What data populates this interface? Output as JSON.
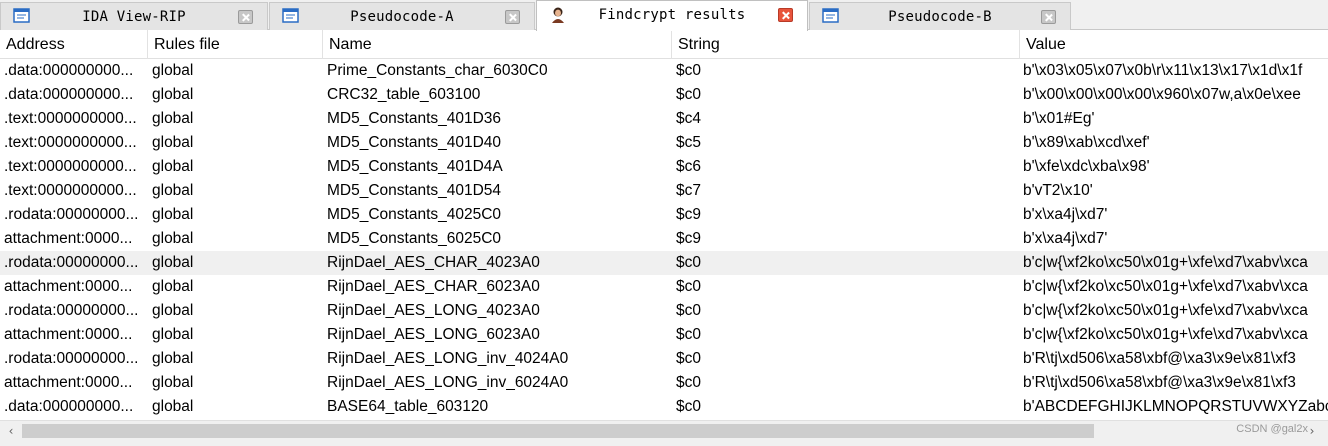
{
  "tabs": [
    {
      "label": "IDA View-RIP",
      "icon": "ida-view-icon",
      "active": false
    },
    {
      "label": "Pseudocode-A",
      "icon": "pseudocode-icon",
      "active": false
    },
    {
      "label": "Findcrypt results",
      "icon": "findcrypt-icon",
      "active": true
    },
    {
      "label": "Pseudocode-B",
      "icon": "pseudocode-icon",
      "active": false
    }
  ],
  "columns": {
    "address": "Address",
    "rules_file": "Rules file",
    "name": "Name",
    "string": "String",
    "value": "Value"
  },
  "rows": [
    {
      "address": ".data:000000000...",
      "rules_file": "global",
      "name": "Prime_Constants_char_6030C0",
      "string": "$c0",
      "value": "b'\\x03\\x05\\x07\\x0b\\r\\x11\\x13\\x17\\x1d\\x1f"
    },
    {
      "address": ".data:000000000...",
      "rules_file": "global",
      "name": "CRC32_table_603100",
      "string": "$c0",
      "value": "b'\\x00\\x00\\x00\\x00\\x960\\x07w,a\\x0e\\xee"
    },
    {
      "address": ".text:0000000000...",
      "rules_file": "global",
      "name": "MD5_Constants_401D36",
      "string": "$c4",
      "value": "b'\\x01#Eg'"
    },
    {
      "address": ".text:0000000000...",
      "rules_file": "global",
      "name": "MD5_Constants_401D40",
      "string": "$c5",
      "value": "b'\\x89\\xab\\xcd\\xef'"
    },
    {
      "address": ".text:0000000000...",
      "rules_file": "global",
      "name": "MD5_Constants_401D4A",
      "string": "$c6",
      "value": "b'\\xfe\\xdc\\xba\\x98'"
    },
    {
      "address": ".text:0000000000...",
      "rules_file": "global",
      "name": "MD5_Constants_401D54",
      "string": "$c7",
      "value": "b'vT2\\x10'"
    },
    {
      "address": ".rodata:00000000...",
      "rules_file": "global",
      "name": "MD5_Constants_4025C0",
      "string": "$c9",
      "value": "b'x\\xa4j\\xd7'"
    },
    {
      "address": "attachment:0000...",
      "rules_file": "global",
      "name": "MD5_Constants_6025C0",
      "string": "$c9",
      "value": "b'x\\xa4j\\xd7'"
    },
    {
      "address": ".rodata:00000000...",
      "rules_file": "global",
      "name": "RijnDael_AES_CHAR_4023A0",
      "string": "$c0",
      "value": "b'c|w{\\xf2ko\\xc50\\x01g+\\xfe\\xd7\\xabv\\xca"
    },
    {
      "address": "attachment:0000...",
      "rules_file": "global",
      "name": "RijnDael_AES_CHAR_6023A0",
      "string": "$c0",
      "value": "b'c|w{\\xf2ko\\xc50\\x01g+\\xfe\\xd7\\xabv\\xca"
    },
    {
      "address": ".rodata:00000000...",
      "rules_file": "global",
      "name": "RijnDael_AES_LONG_4023A0",
      "string": "$c0",
      "value": "b'c|w{\\xf2ko\\xc50\\x01g+\\xfe\\xd7\\xabv\\xca"
    },
    {
      "address": "attachment:0000...",
      "rules_file": "global",
      "name": "RijnDael_AES_LONG_6023A0",
      "string": "$c0",
      "value": "b'c|w{\\xf2ko\\xc50\\x01g+\\xfe\\xd7\\xabv\\xca"
    },
    {
      "address": ".rodata:00000000...",
      "rules_file": "global",
      "name": "RijnDael_AES_LONG_inv_4024A0",
      "string": "$c0",
      "value": "b'R\\tj\\xd506\\xa58\\xbf@\\xa3\\x9e\\x81\\xf3"
    },
    {
      "address": "attachment:0000...",
      "rules_file": "global",
      "name": "RijnDael_AES_LONG_inv_6024A0",
      "string": "$c0",
      "value": "b'R\\tj\\xd506\\xa58\\xbf@\\xa3\\x9e\\x81\\xf3"
    },
    {
      "address": ".data:000000000...",
      "rules_file": "global",
      "name": "BASE64_table_603120",
      "string": "$c0",
      "value": "b'ABCDEFGHIJKLMNOPQRSTUVWXYZabc"
    }
  ],
  "selected_row_index": 8,
  "watermark": "CSDN @gal2x"
}
